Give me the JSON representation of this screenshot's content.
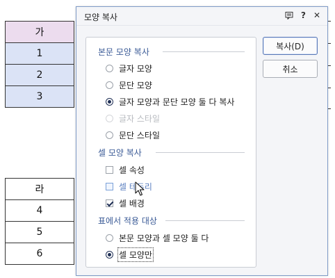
{
  "background": {
    "table1": {
      "header": "가",
      "rows": [
        "1",
        "2",
        "3"
      ]
    },
    "table2": {
      "header": "라",
      "rows": [
        "4",
        "5",
        "6"
      ]
    }
  },
  "dialog": {
    "title": "모양 복사",
    "titlebar_icons": [
      "comment-icon",
      "help-icon",
      "close-icon"
    ],
    "help_glyph": "?",
    "close_glyph": "✕",
    "sections": {
      "body": {
        "title": "본문 모양 복사",
        "options": [
          {
            "label": "글자 모양",
            "checked": false,
            "disabled": false
          },
          {
            "label": "문단 모양",
            "checked": false,
            "disabled": false
          },
          {
            "label": "글자 모양과 문단 모양 둘 다 복사",
            "checked": true,
            "disabled": false
          },
          {
            "label": "글자 스타일",
            "checked": false,
            "disabled": true
          },
          {
            "label": "문단 스타일",
            "checked": false,
            "disabled": false
          }
        ]
      },
      "cell": {
        "title": "셀 모양 복사",
        "options": [
          {
            "label": "셀 속성",
            "checked": false
          },
          {
            "label": "셀 테두리",
            "checked": false
          },
          {
            "label": "셀 배경",
            "checked": true
          }
        ]
      },
      "target": {
        "title": "표에서 적용 대상",
        "options": [
          {
            "label": "본문 모양과 셀 모양 둘 다",
            "checked": false
          },
          {
            "label": "셀 모양만",
            "checked": true
          }
        ]
      }
    },
    "buttons": {
      "copy": "복사(D)",
      "cancel": "취소"
    }
  },
  "colors": {
    "header_fill": "#ecdcee",
    "row_fill": "#dbe3f6",
    "section_title": "#3a5a96",
    "dialog_border": "#7f9bc7"
  }
}
